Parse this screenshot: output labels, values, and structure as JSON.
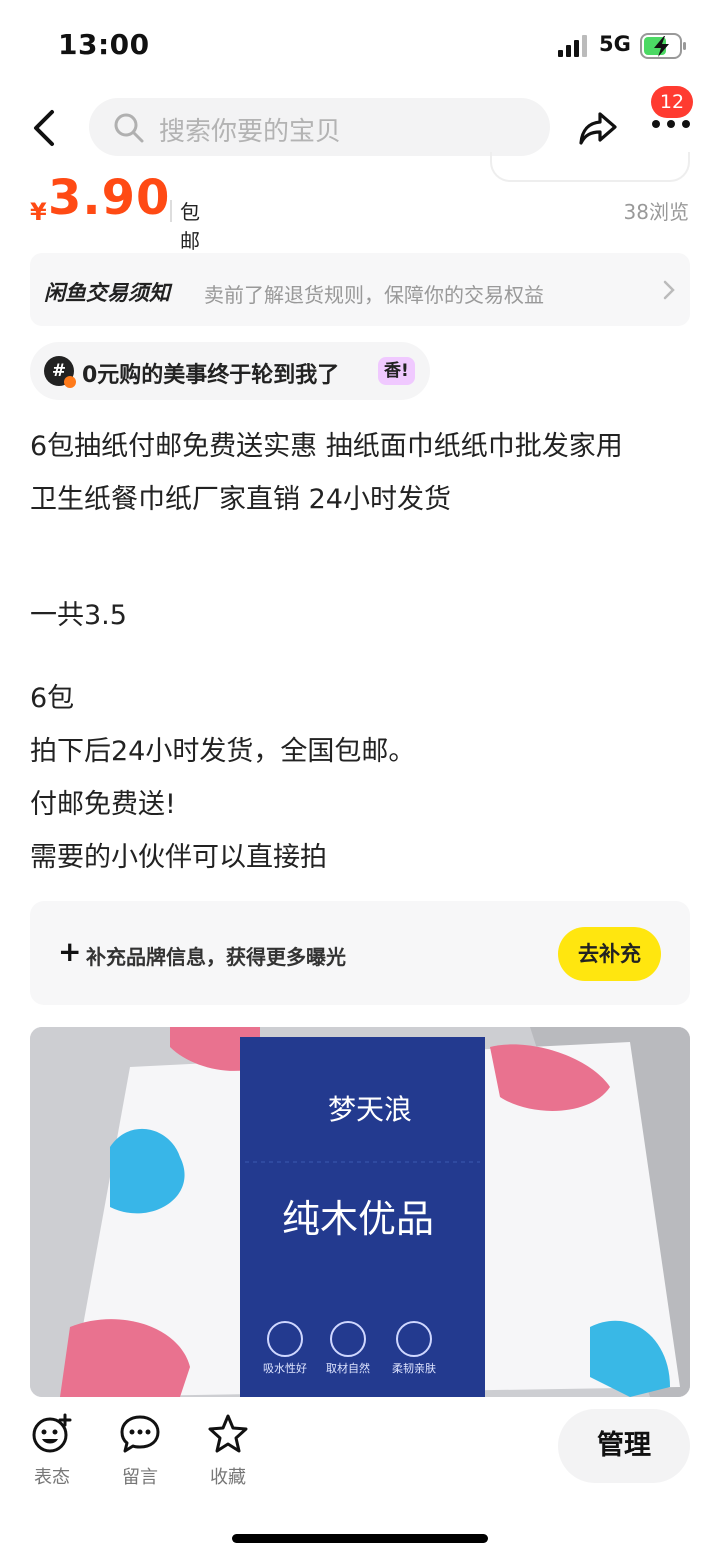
{
  "status_bar": {
    "time": "13:00",
    "network": "5G"
  },
  "nav": {
    "search_placeholder": "搜索你要的宝贝",
    "badge_count": "12"
  },
  "price": {
    "currency": "¥",
    "amount": "3.90",
    "shipping": "包邮",
    "views": "38浏览"
  },
  "notice": {
    "title": "闲鱼交易须知",
    "text": "卖前了解退货规则，保障你的交易权益"
  },
  "topic": {
    "hash": "#",
    "label": "0元购的美事终于轮到我了",
    "tag": "香!"
  },
  "description": {
    "title_line1": "6包抽纸付邮免费送实惠 抽纸面巾纸纸巾批发家用",
    "title_line2": "卫生纸餐巾纸厂家直销 24小时发货",
    "total": "一共3.5",
    "line_pack": "6包",
    "line_ship": "拍下后24小时发货，全国包邮。",
    "line_free": "付邮免费送!",
    "line_need": "需要的小伙伴可以直接拍"
  },
  "brand": {
    "plus": "+",
    "text": "补充品牌信息，获得更多曝光",
    "button": "去补充"
  },
  "product_image": {
    "brand_mark": "梦天浪",
    "package_text": "纯木优品",
    "features": [
      "吸水性好",
      "取材自然",
      "柔韧亲肤"
    ]
  },
  "bottom_bar": {
    "actions": [
      {
        "label": "表态",
        "icon": "emoji-plus-icon"
      },
      {
        "label": "留言",
        "icon": "chat-bubble-icon"
      },
      {
        "label": "收藏",
        "icon": "star-icon"
      }
    ],
    "manage": "管理"
  },
  "colors": {
    "price": "#ff4a14",
    "accent_yellow": "#ffe60f",
    "badge": "#ff3b30"
  }
}
